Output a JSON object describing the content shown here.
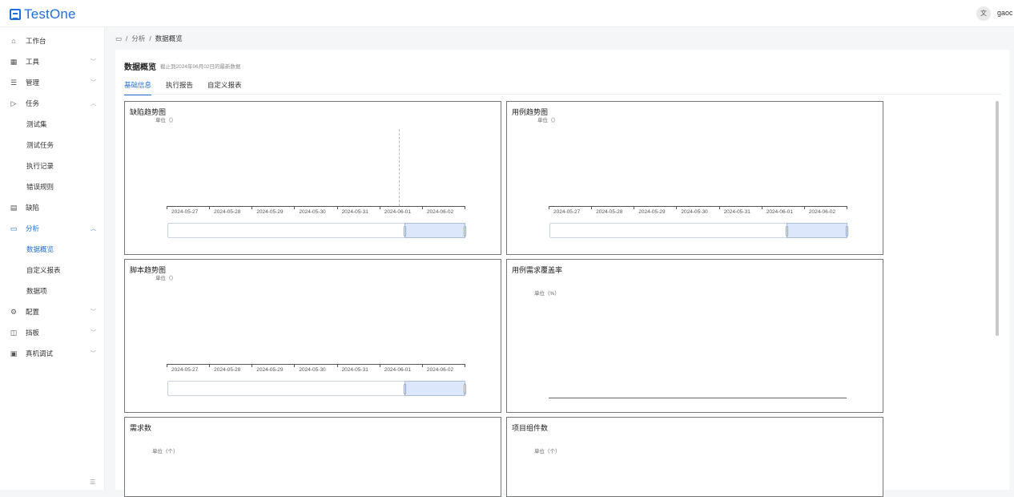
{
  "header": {
    "logo_text": "TestOne",
    "lang_icon": "文",
    "user": "gaoc"
  },
  "sidebar": {
    "items": [
      {
        "label": "工作台",
        "icon": "home-icon",
        "glyph": "⌂",
        "arrow": ""
      },
      {
        "label": "工具",
        "icon": "grid-icon",
        "glyph": "▦",
        "arrow": "﹀"
      },
      {
        "label": "管理",
        "icon": "list-icon",
        "glyph": "☰",
        "arrow": "﹀"
      },
      {
        "label": "任务",
        "icon": "send-icon",
        "glyph": "▷",
        "arrow": "︿"
      },
      {
        "label": "测试集",
        "icon": "",
        "glyph": "",
        "arrow": ""
      },
      {
        "label": "测试任务",
        "icon": "",
        "glyph": "",
        "arrow": ""
      },
      {
        "label": "执行记录",
        "icon": "",
        "glyph": "",
        "arrow": ""
      },
      {
        "label": "错误规则",
        "icon": "",
        "glyph": "",
        "arrow": ""
      },
      {
        "label": "缺陷",
        "icon": "document-icon",
        "glyph": "▤",
        "arrow": ""
      },
      {
        "label": "分析",
        "icon": "monitor-icon",
        "glyph": "▭",
        "arrow": "︿"
      },
      {
        "label": "数据概览",
        "icon": "",
        "glyph": "",
        "arrow": ""
      },
      {
        "label": "自定义报表",
        "icon": "",
        "glyph": "",
        "arrow": ""
      },
      {
        "label": "数据项",
        "icon": "",
        "glyph": "",
        "arrow": ""
      },
      {
        "label": "配置",
        "icon": "gear-icon",
        "glyph": "⚙",
        "arrow": "﹀"
      },
      {
        "label": "挡板",
        "icon": "panel-icon",
        "glyph": "◫",
        "arrow": "﹀"
      },
      {
        "label": "真机调试",
        "icon": "device-icon",
        "glyph": "▣",
        "arrow": "﹀"
      }
    ],
    "collapse_glyph": "☰"
  },
  "breadcrumb": {
    "home_glyph": "▭",
    "sep": "/",
    "level1": "分析",
    "current": "数据概览"
  },
  "page": {
    "title": "数据概览",
    "subtitle": "截止到2024年06月02日的最新数据",
    "tabs": [
      "基础信息",
      "执行报告",
      "自定义报表"
    ]
  },
  "cards": {
    "defect": {
      "title": "缺陷趋势图",
      "unit": "单位（）"
    },
    "case": {
      "title": "用例趋势图",
      "unit": "单位（）"
    },
    "script": {
      "title": "脚本趋势图",
      "unit": "单位（）"
    },
    "coverage": {
      "title": "用例需求覆盖率",
      "unit": "单位（%）"
    },
    "requirements": {
      "title": "需求数",
      "unit": "单位（个）"
    },
    "components": {
      "title": "项目组件数",
      "unit": "单位（个）"
    }
  },
  "chart_data": [
    {
      "type": "line",
      "title": "缺陷趋势图",
      "ylabel": "单位（）",
      "categories": [
        "2024-05-27",
        "2024-05-28",
        "2024-05-29",
        "2024-05-30",
        "2024-05-31",
        "2024-06-01",
        "2024-06-02"
      ],
      "series": []
    },
    {
      "type": "line",
      "title": "用例趋势图",
      "ylabel": "单位（）",
      "categories": [
        "2024-05-27",
        "2024-05-28",
        "2024-05-29",
        "2024-05-30",
        "2024-05-31",
        "2024-06-01",
        "2024-06-02"
      ],
      "series": []
    },
    {
      "type": "line",
      "title": "脚本趋势图",
      "ylabel": "单位（）",
      "categories": [
        "2024-05-27",
        "2024-05-28",
        "2024-05-29",
        "2024-05-30",
        "2024-05-31",
        "2024-06-01",
        "2024-06-02"
      ],
      "series": []
    },
    {
      "type": "bar",
      "title": "用例需求覆盖率",
      "ylabel": "单位（%）",
      "categories": [],
      "values": []
    },
    {
      "type": "bar",
      "title": "需求数",
      "ylabel": "单位（个）",
      "categories": [],
      "values": []
    },
    {
      "type": "bar",
      "title": "项目组件数",
      "ylabel": "单位（个）",
      "categories": [],
      "values": []
    }
  ]
}
